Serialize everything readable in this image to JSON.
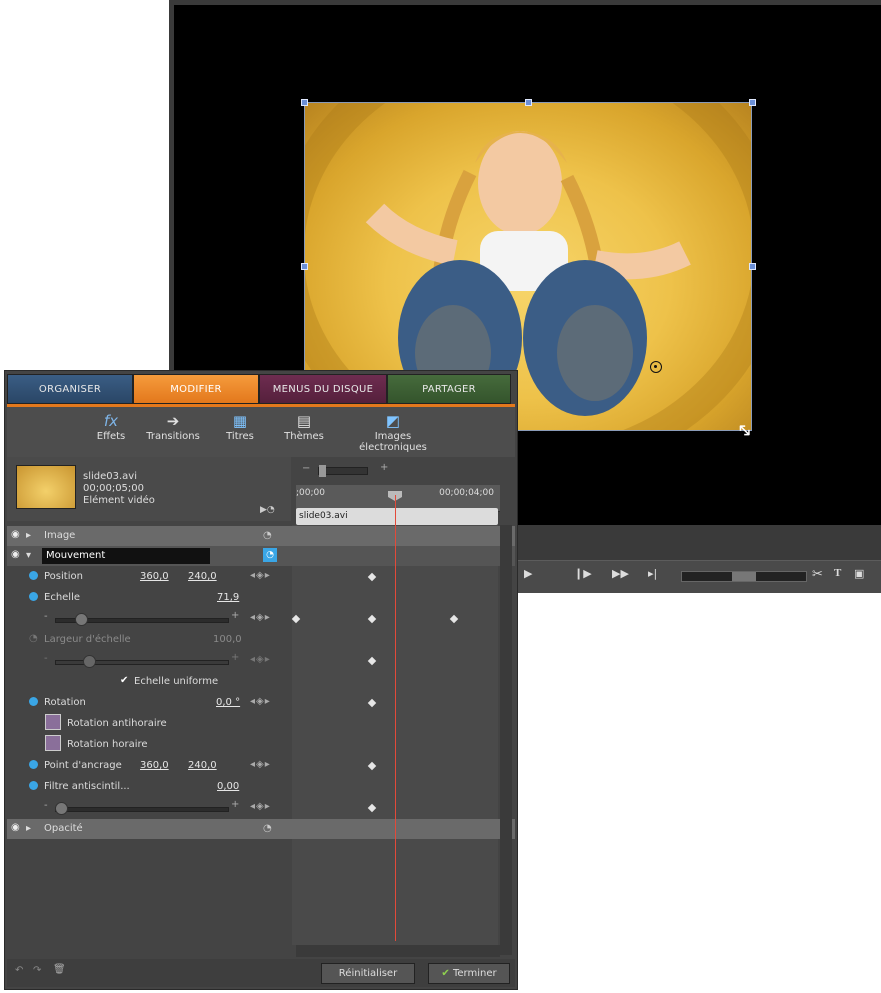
{
  "tabs": {
    "organiser": "ORGANISER",
    "modifier": "MODIFIER",
    "menus": "MENUS DU DISQUE",
    "partager": "PARTAGER"
  },
  "tools": {
    "effets": "Effets",
    "transitions": "Transitions",
    "titres": "Titres",
    "themes": "Thèmes",
    "images": "Images électroniques"
  },
  "clip": {
    "name": "slide03.avi",
    "duration": "00;00;05;00",
    "type": "Elément vidéo"
  },
  "timeline": {
    "start": ";00;00",
    "end": "00;00;04;00",
    "clip_label": "slide03.avi"
  },
  "properties": {
    "image": "Image",
    "mouvement": "Mouvement",
    "position_label": "Position",
    "position_x": "360,0",
    "position_y": "240,0",
    "echelle_label": "Echelle",
    "echelle_value": "71,9",
    "largeur_label": "Largeur d'échelle",
    "largeur_value": "100,0",
    "echelle_uniforme": "Echelle uniforme",
    "rotation_label": "Rotation",
    "rotation_value": "0,0 °",
    "rotation_anti": "Rotation antihoraire",
    "rotation_horaire": "Rotation horaire",
    "ancrage_label": "Point d'ancrage",
    "ancrage_x": "360,0",
    "ancrage_y": "240,0",
    "filtre_label": "Filtre antiscintil...",
    "filtre_value": "0,00",
    "opacite": "Opacité"
  },
  "buttons": {
    "reset": "Réinitialiser",
    "done": "Terminer"
  },
  "colors": {
    "organiser": "#2f4f73",
    "modifier": "#e8822a",
    "menus": "#602440",
    "partager": "#3b5e33",
    "playhead": "#e24a3a",
    "stopwatch": "#3aa6e6"
  }
}
